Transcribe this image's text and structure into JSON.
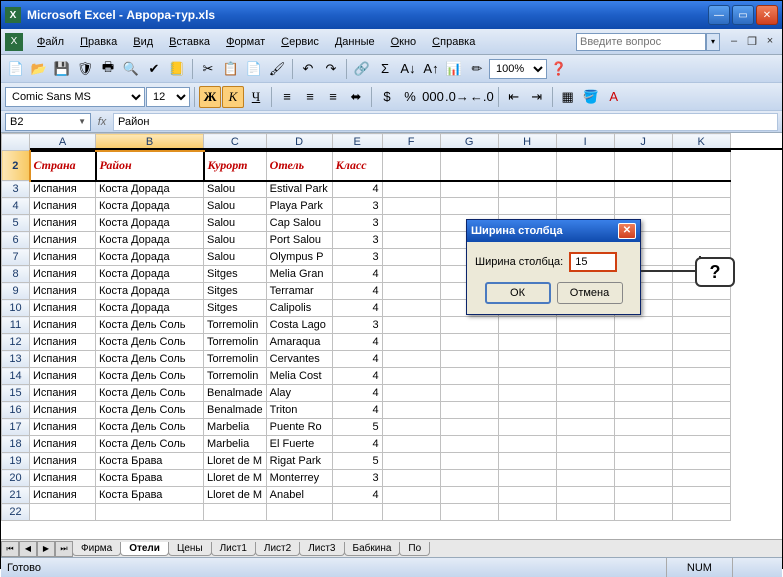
{
  "window": {
    "title": "Microsoft Excel - Аврора-тур.xls"
  },
  "menu": {
    "items": [
      "Файл",
      "Правка",
      "Вид",
      "Вставка",
      "Формат",
      "Сервис",
      "Данные",
      "Окно",
      "Справка"
    ],
    "search_placeholder": "Введите вопрос"
  },
  "format_bar": {
    "font": "Comic Sans MS",
    "size": "12",
    "bold": "Ж",
    "italic": "К",
    "underline": "Ч"
  },
  "zoom": "100%",
  "namebox": "B2",
  "formula": "Район",
  "columns": [
    "A",
    "B",
    "C",
    "D",
    "E",
    "F",
    "G",
    "H",
    "I",
    "J",
    "K"
  ],
  "headers": [
    "Страна",
    "Район",
    "Курорт",
    "Отель",
    "Класс"
  ],
  "rows": [
    {
      "n": 3,
      "c": [
        "Испания",
        "Коста Дорада",
        "Salou",
        "Estival Park",
        "4"
      ]
    },
    {
      "n": 4,
      "c": [
        "Испания",
        "Коста Дорада",
        "Salou",
        "Playa Park",
        "3"
      ]
    },
    {
      "n": 5,
      "c": [
        "Испания",
        "Коста Дорада",
        "Salou",
        "Cap Salou",
        "3"
      ]
    },
    {
      "n": 6,
      "c": [
        "Испания",
        "Коста Дорада",
        "Salou",
        "Port Salou",
        "3"
      ]
    },
    {
      "n": 7,
      "c": [
        "Испания",
        "Коста Дорада",
        "Salou",
        "Olympus P",
        "3"
      ]
    },
    {
      "n": 8,
      "c": [
        "Испания",
        "Коста Дорада",
        "Sitges",
        "Melia Gran",
        "4"
      ]
    },
    {
      "n": 9,
      "c": [
        "Испания",
        "Коста Дорада",
        "Sitges",
        "Terramar",
        "4"
      ]
    },
    {
      "n": 10,
      "c": [
        "Испания",
        "Коста Дорада",
        "Sitges",
        "Calipolis",
        "4"
      ]
    },
    {
      "n": 11,
      "c": [
        "Испания",
        "Коста Дель Соль",
        "Torremolin",
        "Costa Lago",
        "3"
      ]
    },
    {
      "n": 12,
      "c": [
        "Испания",
        "Коста Дель Соль",
        "Torremolin",
        "Amaraqua",
        "4"
      ]
    },
    {
      "n": 13,
      "c": [
        "Испания",
        "Коста Дель Соль",
        "Torremolin",
        "Cervantes",
        "4"
      ]
    },
    {
      "n": 14,
      "c": [
        "Испания",
        "Коста Дель Соль",
        "Torremolin",
        "Melia Cost",
        "4"
      ]
    },
    {
      "n": 15,
      "c": [
        "Испания",
        "Коста Дель Соль",
        "Benalmade",
        "Alay",
        "4"
      ]
    },
    {
      "n": 16,
      "c": [
        "Испания",
        "Коста Дель Соль",
        "Benalmade",
        "Triton",
        "4"
      ]
    },
    {
      "n": 17,
      "c": [
        "Испания",
        "Коста Дель Соль",
        "Marbelia",
        "Puente Ro",
        "5"
      ]
    },
    {
      "n": 18,
      "c": [
        "Испания",
        "Коста Дель Соль",
        "Marbelia",
        "El Fuerte",
        "4"
      ]
    },
    {
      "n": 19,
      "c": [
        "Испания",
        "Коста Брава",
        "Lloret de M",
        "Rigat Park",
        "5"
      ]
    },
    {
      "n": 20,
      "c": [
        "Испания",
        "Коста Брава",
        "Lloret de M",
        "Monterrey",
        "3"
      ]
    },
    {
      "n": 21,
      "c": [
        "Испания",
        "Коста Брава",
        "Lloret de M",
        "Anabel",
        "4"
      ]
    }
  ],
  "sheets": [
    "Фирма",
    "Отели",
    "Цены",
    "Лист1",
    "Лист2",
    "Лист3",
    "Бабкина",
    "По"
  ],
  "active_sheet": 1,
  "status": {
    "ready": "Готово",
    "num": "NUM"
  },
  "dialog": {
    "title": "Ширина столбца",
    "label": "Ширина столбца:",
    "value": "15",
    "ok": "ОК",
    "cancel": "Отмена"
  },
  "callout": "?"
}
